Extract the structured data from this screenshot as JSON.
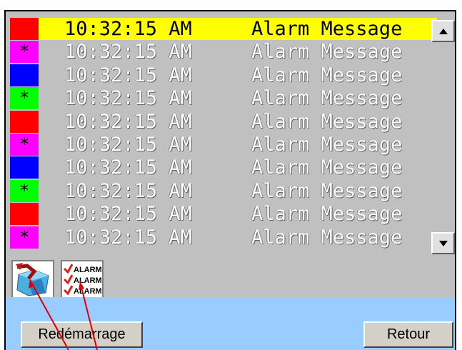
{
  "alarms": [
    {
      "time": "10:32:15 AM",
      "message": "Alarm Message",
      "color": "#ff0000",
      "symbol": "",
      "selected": true
    },
    {
      "time": "10:32:15 AM",
      "message": "Alarm Message",
      "color": "#ff00ff",
      "symbol": "*",
      "selected": false
    },
    {
      "time": "10:32:15 AM",
      "message": "Alarm Message",
      "color": "#0000ff",
      "symbol": "",
      "selected": false
    },
    {
      "time": "10:32:15 AM",
      "message": "Alarm Message",
      "color": "#00ff00",
      "symbol": "*",
      "selected": false
    },
    {
      "time": "10:32:15 AM",
      "message": "Alarm Message",
      "color": "#ff0000",
      "symbol": "",
      "selected": false
    },
    {
      "time": "10:32:15 AM",
      "message": "Alarm Message",
      "color": "#ff00ff",
      "symbol": "*",
      "selected": false
    },
    {
      "time": "10:32:15 AM",
      "message": "Alarm Message",
      "color": "#0000ff",
      "symbol": "",
      "selected": false
    },
    {
      "time": "10:32:15 AM",
      "message": "Alarm Message",
      "color": "#00ff00",
      "symbol": "*",
      "selected": false
    },
    {
      "time": "10:32:15 AM",
      "message": "Alarm Message",
      "color": "#ff0000",
      "symbol": "",
      "selected": false
    },
    {
      "time": "10:32:15 AM",
      "message": "Alarm Message",
      "color": "#ff00ff",
      "symbol": "*",
      "selected": false
    }
  ],
  "selection_color": "#ffff00",
  "icons": {
    "clear": "clear-alarms-icon",
    "alarm_list": "alarm-list-icon",
    "alarm_list_text": [
      "ALARM",
      "ALARM",
      "ALARM"
    ]
  },
  "buttons": {
    "restart": "Redémarrage",
    "back": "Retour"
  }
}
